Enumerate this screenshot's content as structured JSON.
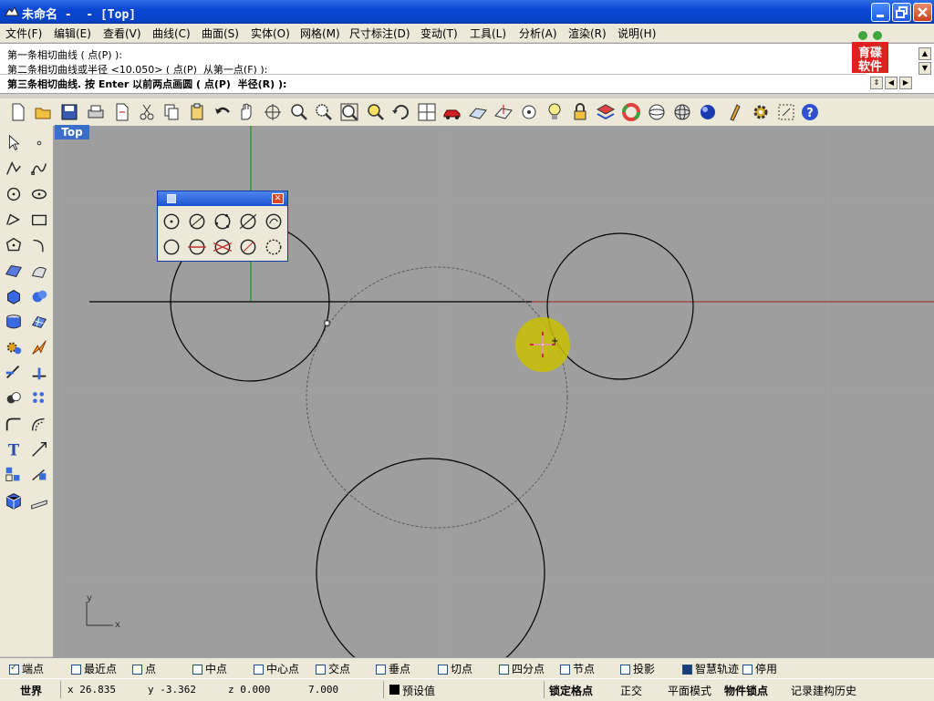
{
  "window": {
    "title": "未命名 -  - [Top]"
  },
  "menu": [
    "文件(F)",
    "编辑(E)",
    "查看(V)",
    "曲线(C)",
    "曲面(S)",
    "实体(O)",
    "网格(M)",
    "尺寸标注(D)",
    "变动(T)",
    "工具(L)",
    "分析(A)",
    "渲染(R)",
    "说明(H)"
  ],
  "command": {
    "history": [
      "第一条相切曲线 ( 点(P) ):",
      "第二条相切曲线或半径 <10.050> ( 点(P)  从第一点(F) ):"
    ],
    "prompt": "第三条相切曲线. 按 Enter 以前两点画圆 ( 点(P)  半径(R) ):"
  },
  "logo": {
    "text": "育碟软件"
  },
  "toolbar_icons": [
    "new-file-icon",
    "open-file-icon",
    "save-icon",
    "print-icon",
    "import-icon",
    "cut-icon",
    "copy-icon",
    "paste-icon",
    "undo-icon",
    "pan-hand-icon",
    "rotate-view-icon",
    "zoom-icon",
    "zoom-window-icon",
    "zoom-extents-icon",
    "zoom-selected-icon",
    "rotate-icon",
    "four-viewports-icon",
    "car-icon",
    "grid-plane-icon",
    "construction-plane-icon",
    "camera-target-icon",
    "light-icon",
    "lock-icon",
    "layer-icon",
    "color-wheel-icon",
    "wireframe-sphere-icon",
    "shaded-sphere-icon",
    "render-sphere-icon",
    "pencil-flag-icon",
    "settings-gear-icon",
    "options-icon",
    "help-icon"
  ],
  "left_toolbar_icons": [
    "select-arrow-icon",
    "point-icon",
    "polyline-icon",
    "curve-icon",
    "circle-icon",
    "ellipse-icon",
    "arc-icon",
    "rectangle-icon",
    "polygon-icon",
    "curve-hook-icon",
    "surface-icon",
    "surface-patch-icon",
    "box-icon",
    "sphere-icon",
    "cylinder-icon",
    "mesh-surface-icon",
    "transform-gear-icon",
    "explode-icon",
    "trim-icon",
    "split-icon",
    "boolean-icon",
    "array-icon",
    "fillet-icon",
    "offset-icon",
    "text-icon",
    "scale-icon",
    "group-icon",
    "dimension-icon",
    "box-solid-icon",
    "ruler-icon"
  ],
  "viewport": {
    "label": "Top",
    "axis_y": "y",
    "axis_x": "x"
  },
  "palette_icons": [
    "circle-center-icon",
    "circle-diameter-icon",
    "circle-3point-icon",
    "circle-tangent-icon",
    "circle-around-curve-icon",
    "circle-plain-icon",
    "circle-tangent-two-icon",
    "circle-tangent-three-icon",
    "circle-fit-icon",
    "circle-deformable-icon"
  ],
  "snaps": [
    {
      "label": "端点",
      "checked": true
    },
    {
      "label": "最近点",
      "checked": false
    },
    {
      "label": "点",
      "checked": false
    },
    {
      "label": "中点",
      "checked": false
    },
    {
      "label": "中心点",
      "checked": false
    },
    {
      "label": "交点",
      "checked": false
    },
    {
      "label": "垂点",
      "checked": false
    },
    {
      "label": "切点",
      "checked": false
    },
    {
      "label": "四分点",
      "checked": false
    },
    {
      "label": "节点",
      "checked": false
    },
    {
      "label": "投影",
      "checked": false
    },
    {
      "label": "智慧轨迹",
      "checked": true
    },
    {
      "label": "停用",
      "checked": false
    }
  ],
  "status": {
    "cplane": "世界",
    "x": "x 26.835",
    "y": "y -3.362",
    "z": "z 0.000",
    "extra": "7.000",
    "layer": "预设值",
    "grid_snap": "锁定格点",
    "ortho": "正交",
    "planar": "平面模式",
    "osnap": "物件锁点",
    "history": "记录建构历史"
  },
  "colors": {
    "title_blue": "#0a46d2",
    "viewport_bg": "#9e9e9e",
    "x_axis": "#a03a3a",
    "y_axis": "#2a9a3a",
    "cursor_halo": "#c8c000"
  }
}
